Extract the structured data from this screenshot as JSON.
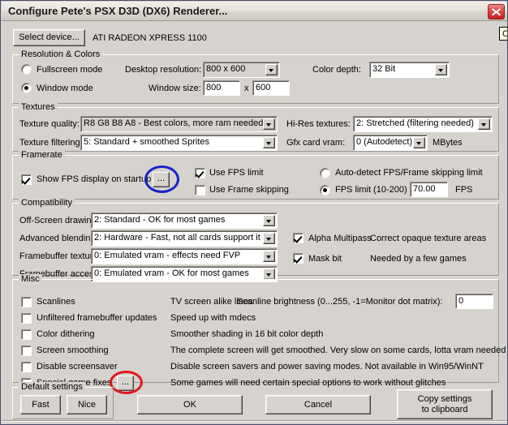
{
  "window": {
    "title": "Configure Pete's PSX D3D (DX6) Renderer...",
    "close_icon": "close-icon"
  },
  "device": {
    "button_label": "Select device...",
    "name": "ATI RADEON XPRESS 1100"
  },
  "tooltip": {
    "text": "C"
  },
  "resolution": {
    "group_title": "Resolution & Colors",
    "fullscreen_label": "Fullscreen mode",
    "window_label": "Window mode",
    "desktop_resolution_label": "Desktop resolution:",
    "desktop_resolution_value": "800 x  600",
    "window_size_label": "Window size:",
    "window_width": "800",
    "window_size_sep": "x",
    "window_height": "600",
    "color_depth_label": "Color depth:",
    "color_depth_value": "32 Bit"
  },
  "textures": {
    "group_title": "Textures",
    "texture_quality_label": "Texture quality:",
    "texture_quality_value": "R8 G8 B8 A8 - Best colors, more ram needed",
    "texture_filtering_label": "Texture filtering:",
    "texture_filtering_value": "5: Standard + smoothed Sprites",
    "hires_label": "Hi-Res textures:",
    "hires_value": "2: Stretched (filtering needed)",
    "vram_label": "Gfx card vram:",
    "vram_value": "0 (Autodetect)",
    "vram_units": "MBytes"
  },
  "framerate": {
    "group_title": "Framerate",
    "show_fps_label": "Show FPS display on startup",
    "show_fps_dots": "...",
    "use_fps_limit_label": "Use FPS limit",
    "use_frame_skipping_label": "Use Frame skipping",
    "autodetect_label": "Auto-detect FPS/Frame skipping limit",
    "fps_limit_label": "FPS limit (10-200) :",
    "fps_limit_value": "70.00",
    "fps_units": "FPS"
  },
  "compatibility": {
    "group_title": "Compatibility",
    "offscreen_label": "Off-Screen drawing:",
    "offscreen_value": "2: Standard - OK for most games",
    "blending_label": "Advanced blending:",
    "blending_value": "2: Hardware - Fast, not all cards support it",
    "fb_textures_label": "Framebuffer textures:",
    "fb_textures_value": "0: Emulated vram - effects need FVP",
    "fb_access_label": "Framebuffer access:",
    "fb_access_value": "0: Emulated vram - OK for most games",
    "alpha_multipass_label": "Alpha Multipass",
    "alpha_multipass_desc": "Correct opaque texture areas",
    "mask_bit_label": "Mask bit",
    "mask_bit_desc": "Needed by a few games"
  },
  "misc": {
    "group_title": "Misc",
    "rows": [
      {
        "label": "Scanlines",
        "desc": "TV screen alike lines"
      },
      {
        "label": "Unfiltered framebuffer updates",
        "desc": "Speed up with mdecs"
      },
      {
        "label": "Color dithering",
        "desc": "Smoother shading in 16 bit color depth"
      },
      {
        "label": "Screen smoothing",
        "desc": "The complete screen will get smoothed. Very slow on some cards, lotta vram needed"
      },
      {
        "label": "Disable screensaver",
        "desc": "Disable screen savers and power saving modes. Not available in Win95/WinNT"
      },
      {
        "label": "Special game fixes",
        "desc": "Some games will need certain special options to work without glitches"
      }
    ],
    "scanline_brightness_label": "Scanline brightness (0...255, -1=Monitor dot matrix):",
    "scanline_brightness_value": "0",
    "special_fixes_dots": "..."
  },
  "defaults": {
    "group_title": "Default settings",
    "fast_label": "Fast",
    "nice_label": "Nice"
  },
  "actions": {
    "ok_label": "OK",
    "cancel_label": "Cancel",
    "copy_line1": "Copy settings",
    "copy_line2": "to clipboard"
  },
  "annotations": {
    "blue_color": "#1a23c8",
    "red_color": "#e01818"
  }
}
